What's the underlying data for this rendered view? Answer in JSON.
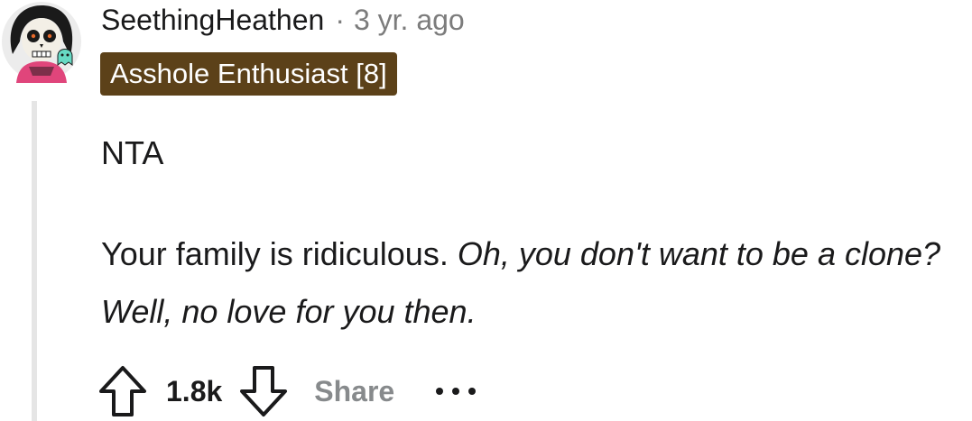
{
  "comment": {
    "author": "SeethingHeathen",
    "separator": "·",
    "timestamp": "3 yr. ago",
    "flair": "Asshole Enthusiast [8]",
    "body_line_1": "NTA",
    "body_line_2_plain": "Your family is ridiculous. ",
    "body_line_2_italic": "Oh, you don't want to be a clone? Well, no love for you then."
  },
  "actions": {
    "upvote_icon": "upvote-arrow-icon",
    "score": "1.8k",
    "downvote_icon": "downvote-arrow-icon",
    "share_label": "Share",
    "more_icon": "more-options-icon"
  },
  "colors": {
    "flair_background": "#5c4119",
    "flair_text": "#ffffff",
    "muted_text": "#7c7c7c",
    "thread_line": "#e5e5e5",
    "avatar_background": "#ececec",
    "avatar_shirt": "#e0457b",
    "avatar_accent": "#67d9c4"
  }
}
